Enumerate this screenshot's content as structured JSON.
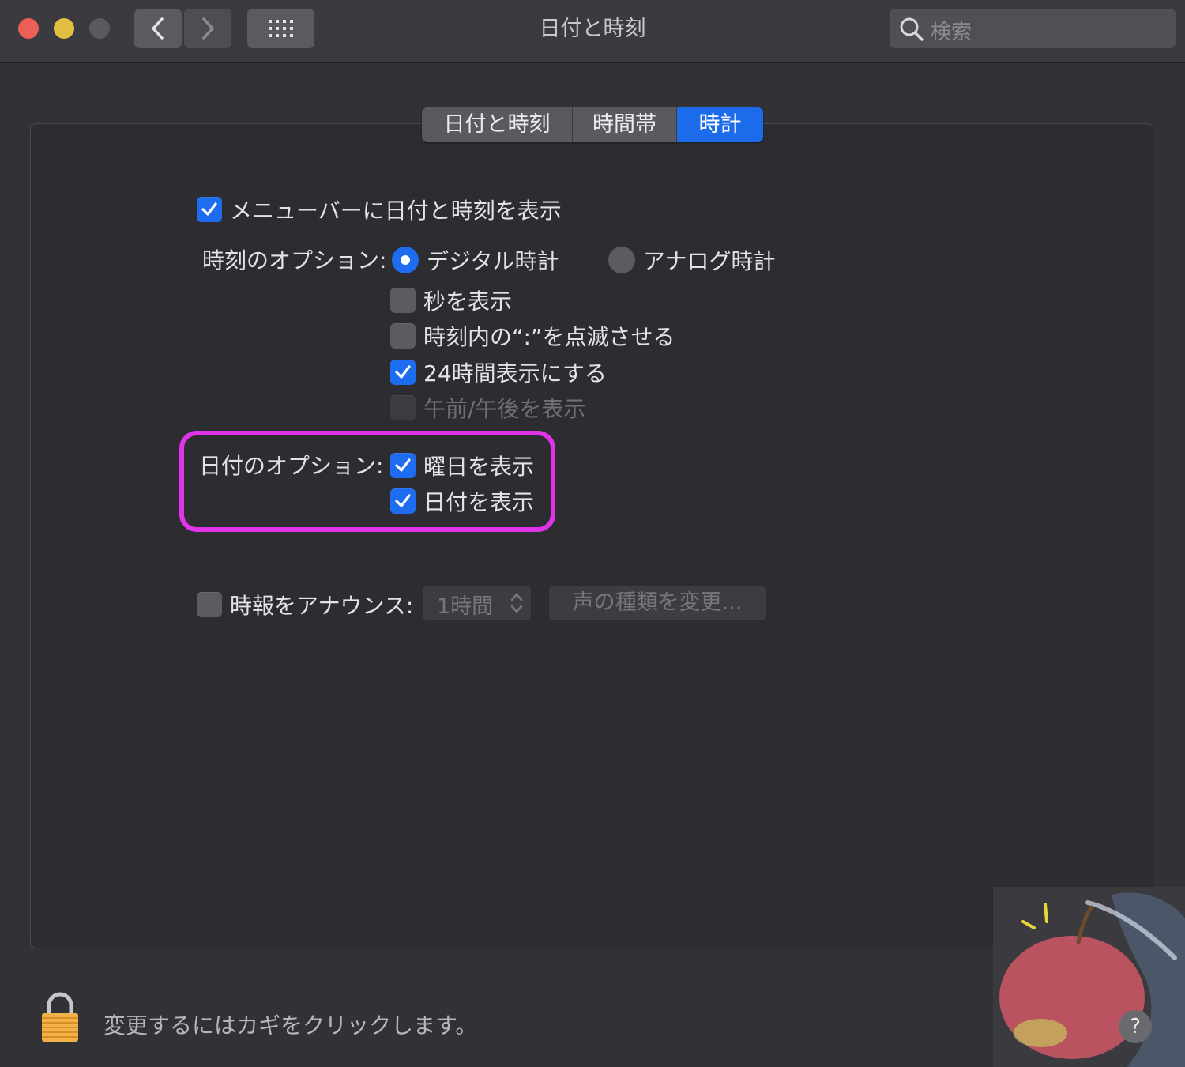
{
  "window": {
    "title": "日付と時刻",
    "search_placeholder": "検索"
  },
  "tabs": [
    {
      "label": "日付と時刻",
      "active": false
    },
    {
      "label": "時間帯",
      "active": false
    },
    {
      "label": "時計",
      "active": true
    }
  ],
  "clock": {
    "show_in_menubar": {
      "label": "メニューバーに日付と時刻を表示",
      "checked": true
    },
    "time_options_label": "時刻のオプション:",
    "digital": {
      "label": "デジタル時計",
      "selected": true
    },
    "analog": {
      "label": "アナログ時計",
      "selected": false
    },
    "show_seconds": {
      "label": "秒を表示",
      "checked": false
    },
    "flash_separators": {
      "label": "時刻内の“:”を点滅させる",
      "checked": false
    },
    "use_24_hour": {
      "label": "24時間表示にする",
      "checked": true
    },
    "show_am_pm": {
      "label": "午前/午後を表示",
      "checked": false,
      "disabled": true
    },
    "date_options_label": "日付のオプション:",
    "show_weekday": {
      "label": "曜日を表示",
      "checked": true
    },
    "show_date": {
      "label": "日付を表示",
      "checked": true
    },
    "announce": {
      "label": "時報をアナウンス:",
      "checked": false,
      "interval": "1時間",
      "voice_button": "声の種類を変更..."
    }
  },
  "footer": {
    "lock_text": "変更するにはカギをクリックします。",
    "help_label": "?"
  },
  "colors": {
    "accent": "#1e6cf0",
    "highlight": "#e133e8",
    "close": "#ec5f57",
    "minimize": "#e1bd41",
    "zoom": "#5a5a5e"
  }
}
